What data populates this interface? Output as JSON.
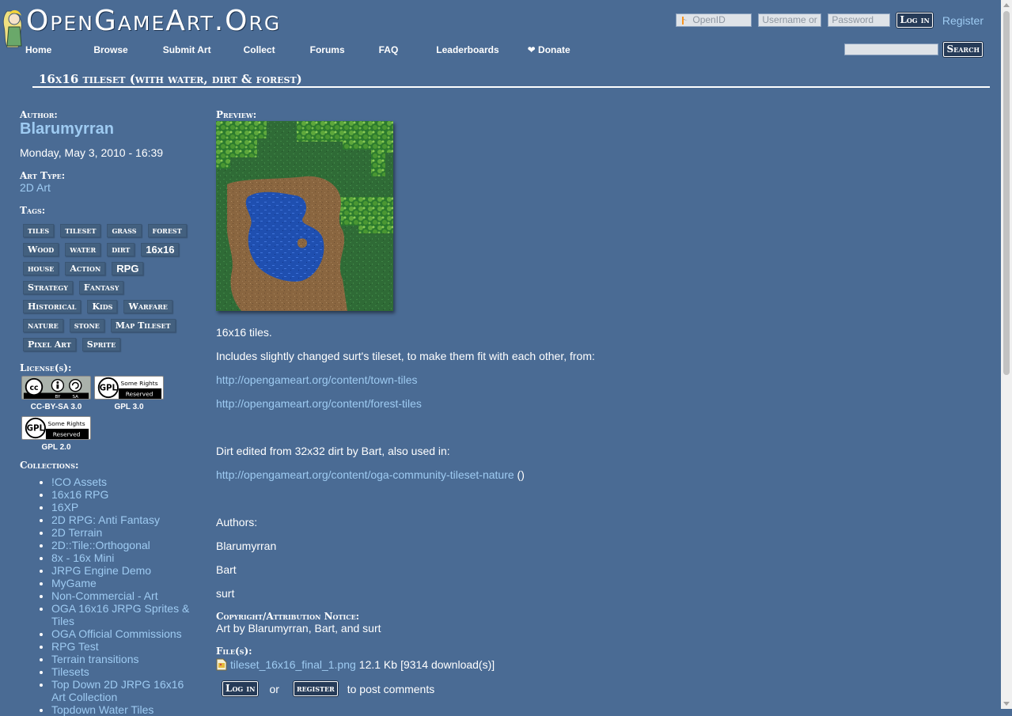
{
  "header": {
    "site_name": "OpenGameArt.Org",
    "login": {
      "openid_placeholder": "OpenID",
      "username_placeholder": "Username or",
      "password_placeholder": "Password",
      "login_label": "Log in",
      "register_label": "Register"
    },
    "nav": [
      "Home",
      "Browse",
      "Submit Art",
      "Collect",
      "Forums",
      "FAQ",
      "Leaderboards",
      "❤ Donate"
    ],
    "search": {
      "button_label": "Search",
      "value": ""
    }
  },
  "page_title": "16x16 tileset (with water, dirt & forest)",
  "sidebar": {
    "author_label": "Author:",
    "author": "Blarumyrran",
    "date": "Monday, May 3, 2010 - 16:39",
    "art_type_label": "Art Type:",
    "art_type": "2D Art",
    "tags_label": "Tags:",
    "tags": [
      [
        "tiles",
        "tileset",
        "grass",
        "forest"
      ],
      [
        "Wood",
        "water",
        "dirt",
        "16x16"
      ],
      [
        "house",
        "Action",
        "RPG"
      ],
      [
        "Strategy",
        "Fantasy"
      ],
      [
        "Historical",
        "Kids",
        "Warfare"
      ],
      [
        "nature",
        "stone",
        "Map Tileset"
      ],
      [
        "Pixel Art",
        "Sprite"
      ]
    ],
    "license_label": "License(s):",
    "licenses": [
      {
        "name": "CC-BY-SA 3.0",
        "icon": "cc-by-sa-icon"
      },
      {
        "name": "GPL 3.0",
        "icon": "gpl-icon"
      },
      {
        "name": "GPL 2.0",
        "icon": "gpl-icon"
      }
    ],
    "license_badge_text": {
      "cc": "cc",
      "by": "BY",
      "sa": "SA",
      "gpl": "GPL",
      "some_rights": "Some Rights",
      "reserved": "Reserved"
    },
    "collections_label": "Collections:",
    "collections": [
      "!CO Assets",
      "16x16 RPG",
      "16XP",
      "2D RPG: Anti Fantasy",
      "2D Terrain",
      "2D::Tile::Orthogonal",
      "8x - 16x Mini",
      "JRPG Engine Demo",
      "MyGame",
      "Non-Commercial - Art",
      "OGA 16x16 JRPG Sprites & Tiles",
      "OGA Official Commissions",
      "RPG Test",
      "Terrain transitions",
      "Tilesets",
      "Top Down 2D JRPG 16x16 Art Collection",
      "Topdown Water Tiles"
    ]
  },
  "main": {
    "preview_label": "Preview:",
    "description": {
      "line1": "16x16 tiles.",
      "line2": "Includes slightly changed surt's tileset, to make them fit with each other, from:",
      "link1": "http://opengameart.org/content/town-tiles",
      "link2": "http://opengameart.org/content/forest-tiles",
      "line3": "Dirt edited from 32x32 dirt by Bart, also used in:",
      "link3": "http://opengameart.org/content/oga-community-tileset-nature",
      "link3_suffix": "()",
      "authors_label": "Authors:",
      "authors": [
        "Blarumyrran",
        "Bart",
        "surt"
      ]
    },
    "copyright_label": "Copyright/Attribution Notice:",
    "copyright": "Art by Blarumyrran, Bart, and surt",
    "files_label": "File(s):",
    "file": {
      "name": "tileset_16x16_final_1.png",
      "size": "12.1 Kb",
      "downloads": "[9314 download(s)]",
      "icon": "image-file-icon"
    },
    "comments": {
      "login_label": "Log in",
      "or": "or",
      "register_label": "register",
      "suffix": "to post comments"
    }
  },
  "colors": {
    "background": "#4a6b94",
    "link": "#9ecbf2",
    "button": "#263b58"
  }
}
